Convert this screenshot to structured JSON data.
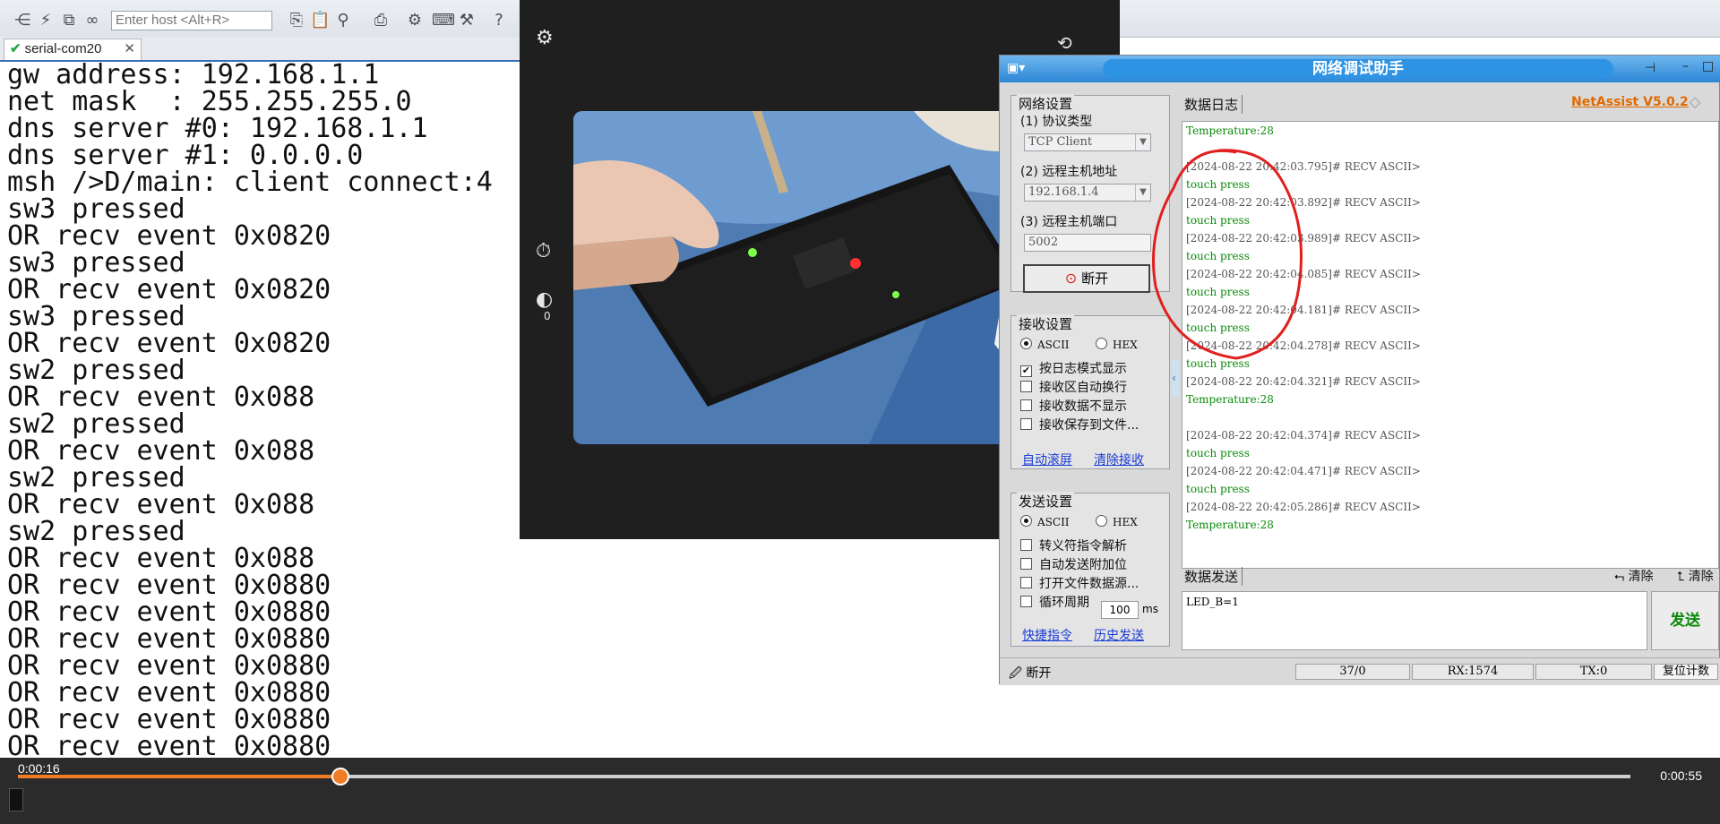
{
  "toolbar": {
    "host_placeholder": "Enter host <Alt+R>",
    "icons": [
      "tree-icon",
      "lightning-icon",
      "window-icon",
      "link-icon",
      "copy-icon",
      "paste-icon",
      "binoculars-icon",
      "print-icon",
      "gear-icon",
      "keyboard-icon",
      "tool-icon",
      "help-icon"
    ]
  },
  "tab": {
    "label": "serial-com20",
    "close": "✕"
  },
  "terminal": {
    "lines": [
      "gw address: 192.168.1.1",
      "net mask  : 255.255.255.0",
      "dns server #0: 192.168.1.1",
      "dns server #1: 0.0.0.0",
      "msh />D/main: client connect:4",
      "sw3 pressed",
      "OR recv event 0x0820",
      "sw3 pressed",
      "OR recv event 0x0820",
      "sw3 pressed",
      "OR recv event 0x0820",
      "sw2 pressed",
      "OR recv event 0x088",
      "sw2 pressed",
      "OR recv event 0x088",
      "sw2 pressed",
      "OR recv event 0x088",
      "sw2 pressed",
      "OR recv event 0x088",
      "OR recv event 0x0880",
      "OR recv event 0x0880",
      "OR recv event 0x0880",
      "OR recv event 0x0880",
      "OR recv event 0x0880",
      "OR recv event 0x0880",
      "OR recv event 0x0880",
      "OR recv event 0x0880"
    ]
  },
  "camera": {
    "timer_count": "0"
  },
  "netassist": {
    "title": "网络调试助手",
    "brand": "NetAssist V5.0.2",
    "net_settings": {
      "title": "网络设置",
      "protocol_label": "(1) 协议类型",
      "protocol_value": "TCP Client",
      "host_label": "(2) 远程主机地址",
      "host_value": "192.168.1.4",
      "port_label": "(3) 远程主机端口",
      "port_value": "5002",
      "disconnect_label": "断开"
    },
    "recv_settings": {
      "title": "接收设置",
      "ascii": "ASCII",
      "hex": "HEX",
      "options": [
        "按日志模式显示",
        "接收区自动换行",
        "接收数据不显示",
        "接收保存到文件..."
      ],
      "checked": [
        true,
        false,
        false,
        false
      ],
      "link_autoscroll": "自动滚屏",
      "link_clear": "清除接收"
    },
    "send_settings": {
      "title": "发送设置",
      "ascii": "ASCII",
      "hex": "HEX",
      "options": [
        "转义符指令解析",
        "自动发送附加位",
        "打开文件数据源...",
        "循环周期"
      ],
      "period_value": "100",
      "period_unit": "ms",
      "link_shortcut": "快捷指令",
      "link_history": "历史发送"
    },
    "log_tab": "数据日志",
    "send_tab": "数据发送",
    "clear1": "清除",
    "clear2": "清除",
    "log": [
      {
        "t": "data",
        "text": "Temperature:28"
      },
      {
        "t": "blank",
        "text": ""
      },
      {
        "t": "head",
        "text": "[2024-08-22 20:42:03.795]# RECV ASCII>"
      },
      {
        "t": "data",
        "text": "touch press"
      },
      {
        "t": "head",
        "text": "[2024-08-22 20:42:03.892]# RECV ASCII>"
      },
      {
        "t": "data",
        "text": "touch press"
      },
      {
        "t": "head",
        "text": "[2024-08-22 20:42:03.989]# RECV ASCII>"
      },
      {
        "t": "data",
        "text": "touch press"
      },
      {
        "t": "head",
        "text": "[2024-08-22 20:42:04.085]# RECV ASCII>"
      },
      {
        "t": "data",
        "text": "touch press"
      },
      {
        "t": "head",
        "text": "[2024-08-22 20:42:04.181]# RECV ASCII>"
      },
      {
        "t": "data",
        "text": "touch press"
      },
      {
        "t": "head",
        "text": "[2024-08-22 20:42:04.278]# RECV ASCII>"
      },
      {
        "t": "data",
        "text": "touch press"
      },
      {
        "t": "head",
        "text": "[2024-08-22 20:42:04.321]# RECV ASCII>"
      },
      {
        "t": "data",
        "text": "Temperature:28"
      },
      {
        "t": "blank",
        "text": ""
      },
      {
        "t": "head",
        "text": "[2024-08-22 20:42:04.374]# RECV ASCII>"
      },
      {
        "t": "data",
        "text": "touch press"
      },
      {
        "t": "head",
        "text": "[2024-08-22 20:42:04.471]# RECV ASCII>"
      },
      {
        "t": "data",
        "text": "touch press"
      },
      {
        "t": "head",
        "text": "[2024-08-22 20:42:05.286]# RECV ASCII>"
      },
      {
        "t": "data",
        "text": "Temperature:28"
      }
    ],
    "send_text": "LED_B=1",
    "send_button": "发送",
    "status": {
      "state": "断开",
      "count": "37/0",
      "rx": "RX:1574",
      "tx": "TX:0",
      "reset": "复位计数"
    }
  },
  "player": {
    "current_time": "0:00:16",
    "total_time": "0:00:55",
    "progress": 0.2
  },
  "colors": {
    "accent": "#f07c26",
    "log_green": "#0a8a0a",
    "link_blue": "#1a3dd4",
    "annotation_red": "#e0201e"
  }
}
